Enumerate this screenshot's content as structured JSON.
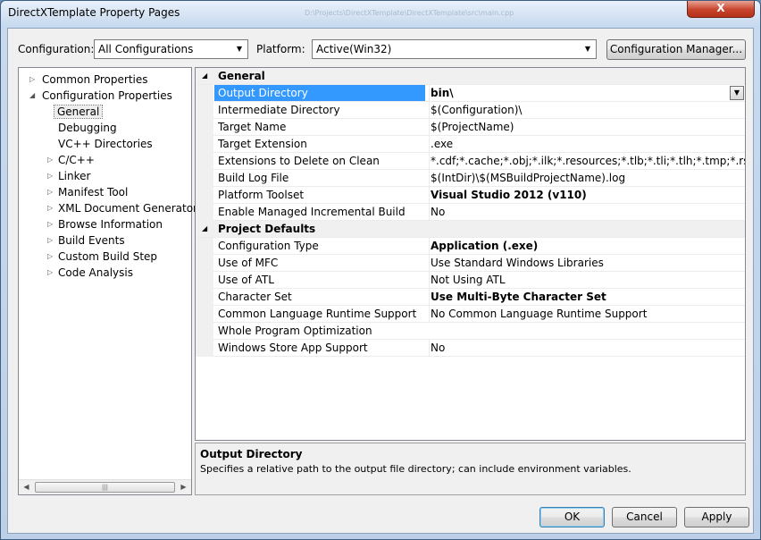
{
  "window": {
    "title": "DirectXTemplate Property Pages",
    "ghost_path": "D:\\Projects\\DirectXTemplate\\DirectXTemplate\\src\\main.cpp",
    "close_glyph": "X"
  },
  "toolbar": {
    "configuration_label": "Configuration:",
    "configuration_value": "All Configurations",
    "platform_label": "Platform:",
    "platform_value": "Active(Win32)",
    "config_manager_label": "Configuration Manager..."
  },
  "tree": {
    "items": [
      {
        "label": "Common Properties",
        "toggle": "▷"
      },
      {
        "label": "Configuration Properties",
        "toggle": "◢"
      },
      {
        "label": "General",
        "toggle": ""
      },
      {
        "label": "Debugging",
        "toggle": ""
      },
      {
        "label": "VC++ Directories",
        "toggle": ""
      },
      {
        "label": "C/C++",
        "toggle": "▷"
      },
      {
        "label": "Linker",
        "toggle": "▷"
      },
      {
        "label": "Manifest Tool",
        "toggle": "▷"
      },
      {
        "label": "XML Document Generator",
        "toggle": "▷"
      },
      {
        "label": "Browse Information",
        "toggle": "▷"
      },
      {
        "label": "Build Events",
        "toggle": "▷"
      },
      {
        "label": "Custom Build Step",
        "toggle": "▷"
      },
      {
        "label": "Code Analysis",
        "toggle": "▷"
      }
    ]
  },
  "grid": {
    "categories": [
      {
        "name": "General",
        "rows": [
          {
            "name": "Output Directory",
            "value": "bin\\"
          },
          {
            "name": "Intermediate Directory",
            "value": "$(Configuration)\\"
          },
          {
            "name": "Target Name",
            "value": "$(ProjectName)"
          },
          {
            "name": "Target Extension",
            "value": ".exe"
          },
          {
            "name": "Extensions to Delete on Clean",
            "value": "*.cdf;*.cache;*.obj;*.ilk;*.resources;*.tlb;*.tli;*.tlh;*.tmp;*.rsp;*.pgc;*.pgd"
          },
          {
            "name": "Build Log File",
            "value": "$(IntDir)\\$(MSBuildProjectName).log"
          },
          {
            "name": "Platform Toolset",
            "value": "Visual Studio 2012 (v110)"
          },
          {
            "name": "Enable Managed Incremental Build",
            "value": "No"
          }
        ]
      },
      {
        "name": "Project Defaults",
        "rows": [
          {
            "name": "Configuration Type",
            "value": "Application (.exe)"
          },
          {
            "name": "Use of MFC",
            "value": "Use Standard Windows Libraries"
          },
          {
            "name": "Use of ATL",
            "value": "Not Using ATL"
          },
          {
            "name": "Character Set",
            "value": "Use Multi-Byte Character Set"
          },
          {
            "name": "Common Language Runtime Support",
            "value": "No Common Language Runtime Support"
          },
          {
            "name": "Whole Program Optimization",
            "value": ""
          },
          {
            "name": "Windows Store App Support",
            "value": "No"
          }
        ]
      }
    ]
  },
  "description": {
    "title": "Output Directory",
    "text": "Specifies a relative path to the output file directory; can include environment variables."
  },
  "buttons": {
    "ok": "OK",
    "cancel": "Cancel",
    "apply": "Apply"
  }
}
